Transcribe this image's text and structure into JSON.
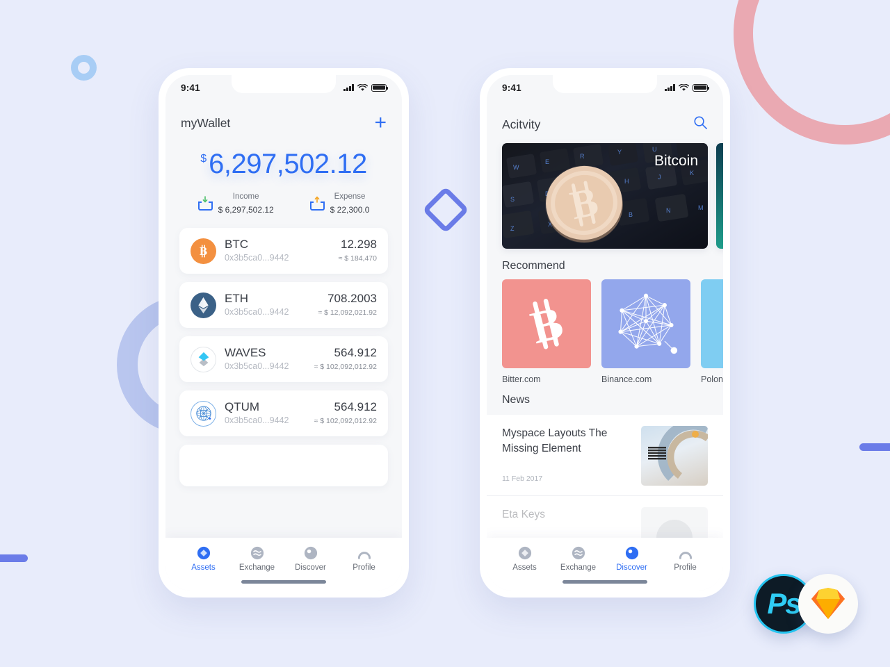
{
  "background": {
    "color": "#e8ecfb",
    "decorations": [
      {
        "name": "ring-blue-small",
        "color": "#a8cdf5"
      },
      {
        "name": "ring-pink-large",
        "color": "#eaa9b2"
      },
      {
        "name": "arc-purple-left",
        "color": "#b9c6ef"
      },
      {
        "name": "bar-left",
        "color": "#6b7ce8"
      },
      {
        "name": "bar-right",
        "color": "#6b7ce8"
      },
      {
        "name": "diamond-center",
        "color": "#6b7ce8"
      }
    ]
  },
  "status_bar": {
    "time": "9:41",
    "signal_icon": "cellular-signal-icon",
    "wifi_icon": "wifi-icon",
    "battery_icon": "battery-icon"
  },
  "wallet_screen": {
    "header": {
      "title": "myWallet",
      "add_label": "+",
      "add_icon": "plus-icon"
    },
    "balance": {
      "currency_symbol": "$",
      "amount": "6,297,502.12",
      "color": "#2f6ef3"
    },
    "stats": [
      {
        "icon": "income-tray-icon",
        "label": "Income",
        "value": "$ 6,297,502.12",
        "arrow_color": "#4cbf6a"
      },
      {
        "icon": "expense-tray-icon",
        "label": "Expense",
        "value": "$ 22,300.0",
        "arrow_color": "#f5a623"
      }
    ],
    "coins": [
      {
        "icon": "bitcoin-coin-icon",
        "symbol": "BTC",
        "address": "0x3b5ca0...9442",
        "amount": "12.298",
        "fiat": "≈ $ 184,470",
        "color": "#f39040"
      },
      {
        "icon": "ethereum-coin-icon",
        "symbol": "ETH",
        "address": "0x3b5ca0...9442",
        "amount": "708.2003",
        "fiat": "≈ $ 12,092,021.92",
        "color": "#3b6187"
      },
      {
        "icon": "waves-coin-icon",
        "symbol": "WAVES",
        "address": "0x3b5ca0...9442",
        "amount": "564.912",
        "fiat": "≈ $ 102,092,012.92",
        "color": "#33c6f4"
      },
      {
        "icon": "qtum-coin-icon",
        "symbol": "QTUM",
        "address": "0x3b5ca0...9442",
        "amount": "564.912",
        "fiat": "≈ $ 102,092,012.92",
        "color": "#4d8fd6"
      }
    ]
  },
  "discover_screen": {
    "header": {
      "title": "Acitvity",
      "search_icon": "search-icon"
    },
    "banners": [
      {
        "name": "bitcoin-keyboard-banner",
        "label": "Bitcoin"
      },
      {
        "name": "aurora-banner",
        "label": ""
      }
    ],
    "recommend": {
      "title": "Recommend",
      "items": [
        {
          "name": "Bitter.com",
          "icon": "bitcoin-logo-icon",
          "color": "#f2938f"
        },
        {
          "name": "Binance.com",
          "icon": "network-graph-icon",
          "color": "#93a7ec"
        },
        {
          "name": "Polone",
          "icon": "poloniex-icon",
          "color": "#7fcdf2"
        }
      ]
    },
    "news": {
      "title": "News",
      "items": [
        {
          "title": "Myspace Layouts The Missing Element",
          "date": "11 Feb 2017",
          "thumb": "ibm-server-thumb"
        },
        {
          "title": "Eta Keys",
          "date": "",
          "thumb": "person-thumb"
        }
      ]
    }
  },
  "tab_bar": {
    "tabs": [
      {
        "label": "Assets",
        "icon": "assets-diamond-icon"
      },
      {
        "label": "Exchange",
        "icon": "exchange-waves-icon"
      },
      {
        "label": "Discover",
        "icon": "discover-compass-icon"
      },
      {
        "label": "Profile",
        "icon": "profile-person-icon"
      }
    ],
    "active_left": "Assets",
    "active_right": "Discover",
    "active_color": "#2f6ef3",
    "inactive_color": "#aeb5c2"
  },
  "app_badges": [
    {
      "name": "photoshop-badge",
      "label": "Ps",
      "color": "#2fcdf5"
    },
    {
      "name": "sketch-badge",
      "label": "",
      "color": "#fdad00"
    }
  ]
}
